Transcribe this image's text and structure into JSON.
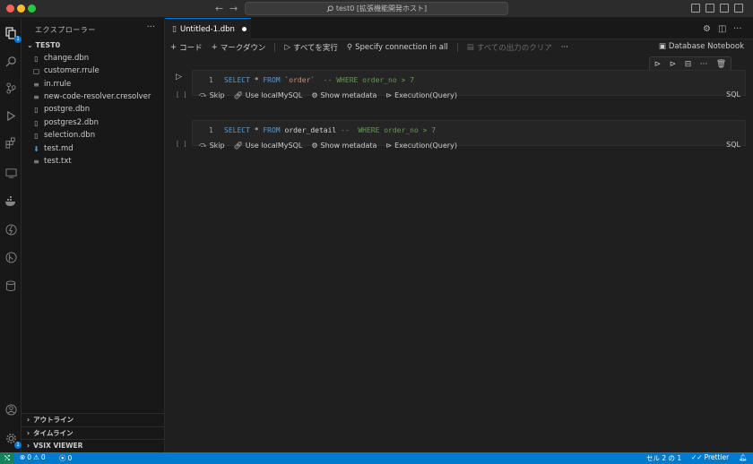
{
  "titlebar": {
    "back": "←",
    "forward": "→",
    "search_text": "test0 [拡張機能開発ホスト]"
  },
  "activity_badge": "1",
  "sidebar": {
    "title": "エクスプローラー",
    "more": "···",
    "folder": "TEST0",
    "files": [
      {
        "name": "change.dbn",
        "icon": "notebook-icon"
      },
      {
        "name": "customer.rrule",
        "icon": "file-icon"
      },
      {
        "name": "in.rrule",
        "icon": "list-icon"
      },
      {
        "name": "new-code-resolver.cresolver",
        "icon": "list-icon"
      },
      {
        "name": "postgre.dbn",
        "icon": "notebook-icon"
      },
      {
        "name": "postgres2.dbn",
        "icon": "notebook-icon"
      },
      {
        "name": "selection.dbn",
        "icon": "notebook-icon"
      },
      {
        "name": "test.md",
        "icon": "markdown-icon"
      },
      {
        "name": "test.txt",
        "icon": "text-icon"
      }
    ],
    "bottom_sections": [
      "アウトライン",
      "タイムライン",
      "VSIX VIEWER"
    ]
  },
  "editor": {
    "tab_label": "Untitled-1.dbn",
    "toolbar": {
      "code": "コード",
      "markdown": "マークダウン",
      "run_all": "すべてを実行",
      "specify": "Specify connection in all",
      "clear_outputs": "すべての出力のクリア",
      "notebook_type": "Database Notebook"
    },
    "cells": [
      {
        "line": "1",
        "exec": "[ ]",
        "code": {
          "select": "SELECT",
          "star": " * ",
          "from": "FROM",
          "table": " `order`",
          "comment": "  -- WHERE order_no > 7"
        },
        "status": {
          "skip": "Skip",
          "use": "Use localMySQL",
          "meta": "Show metadata",
          "exec": "Execution(Query)"
        },
        "lang": "SQL"
      },
      {
        "line": "1",
        "exec": "[ ]",
        "code": {
          "select": "SELECT",
          "star": " * ",
          "from": "FROM",
          "table": " order_detail",
          "comment": " --  WHERE order_no > 7"
        },
        "status": {
          "skip": "Skip",
          "use": "Use localMySQL",
          "meta": "Show metadata",
          "exec": "Execution(Query)"
        },
        "lang": "SQL"
      }
    ]
  },
  "statusbar": {
    "errors": "0",
    "warnings": "0",
    "ports": "0",
    "cell_position": "セル 2 の 1",
    "prettier": "Prettier"
  }
}
